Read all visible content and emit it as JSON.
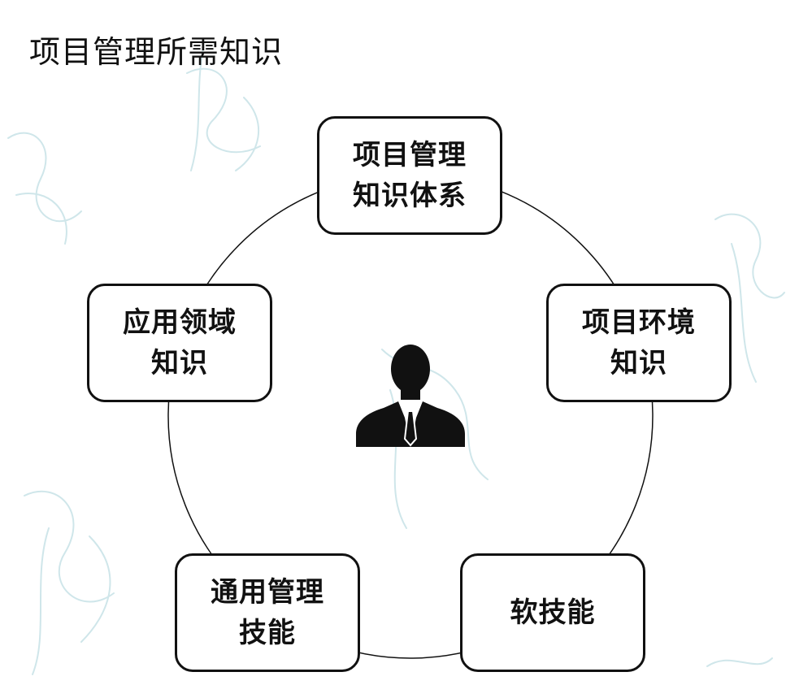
{
  "title": "项目管理所需知识",
  "nodes": [
    {
      "id": "pmbok",
      "label": "项目管理\n知识体系"
    },
    {
      "id": "environment",
      "label": "项目环境\n知识"
    },
    {
      "id": "application",
      "label": "应用领域\n知识"
    },
    {
      "id": "general",
      "label": "通用管理\n技能"
    },
    {
      "id": "soft",
      "label": "软技能"
    }
  ],
  "center_icon": "person-silhouette-icon",
  "colors": {
    "stroke": "#111111",
    "background": "#ffffff",
    "watermark": "#cfe6ea"
  }
}
